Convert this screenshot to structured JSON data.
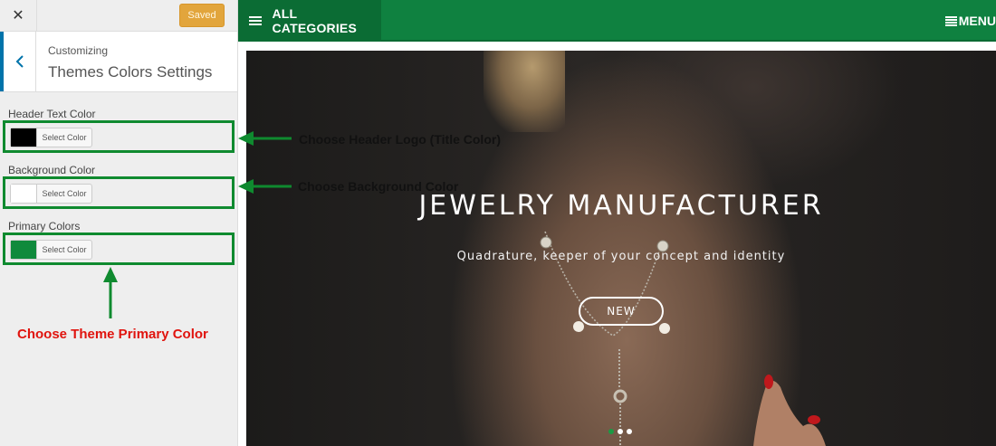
{
  "customizer": {
    "close_glyph": "✕",
    "saved_label": "Saved",
    "section_small": "Customizing",
    "section_title": "Themes Colors Settings",
    "controls": [
      {
        "label": "Header Text Color",
        "button": "Select Color",
        "swatch": "#000000"
      },
      {
        "label": "Background Color",
        "button": "Select Color",
        "swatch": "#ffffff"
      },
      {
        "label": "Primary Colors",
        "button": "Select Color",
        "swatch": "#0f8a3c"
      }
    ]
  },
  "annotations": {
    "header": "Choose Header Logo (Title Color)",
    "background": "Choose Background Color",
    "primary": "Choose Theme Primary Color"
  },
  "site": {
    "nav": {
      "categories": "ALL CATEGORIES",
      "menu": "MENU"
    },
    "hero": {
      "title": "JEWELRY MANUFACTURER",
      "subtitle": "Quadrature, keeper of your concept and identity",
      "button": "NEW",
      "slides": 3,
      "active_slide": 1
    }
  },
  "colors": {
    "brand_green": "#0f8140",
    "annotation_green": "#0f8a2f",
    "annotation_red": "#e0140e",
    "saved_orange": "#e2a53c"
  }
}
